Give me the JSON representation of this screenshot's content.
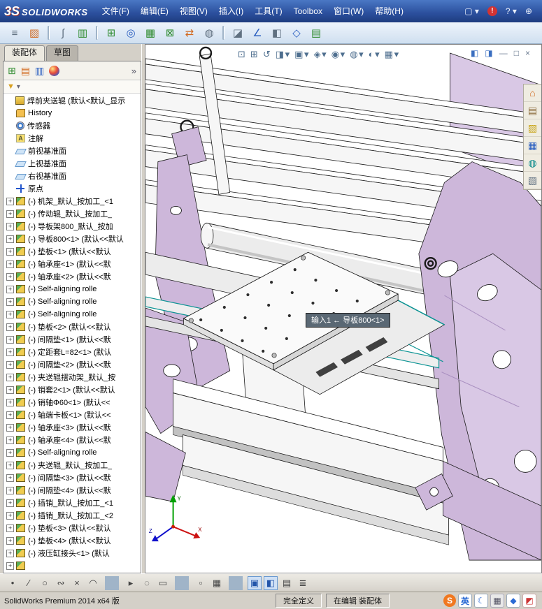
{
  "colors": {
    "titlebar_blue": "#2b4f9d",
    "frame_purple": "#cdb7da",
    "selection_teal": "#0b9393",
    "alert_red": "#d23333"
  },
  "titlebar": {
    "logo_prefix": "3S",
    "logo_text": "SOLIDWORKS",
    "menu": [
      "文件(F)",
      "编辑(E)",
      "视图(V)",
      "插入(I)",
      "工具(T)",
      "Toolbox",
      "窗口(W)",
      "帮助(H)"
    ],
    "right_icons": [
      {
        "name": "new-document-icon",
        "glyph": "▢ ▾"
      },
      {
        "name": "alerts-icon",
        "glyph": "!",
        "cls": "alert"
      },
      {
        "name": "help-menu-icon",
        "glyph": "? ▾"
      },
      {
        "name": "search-icon",
        "glyph": "⊕"
      }
    ]
  },
  "toolbar": {
    "icons": [
      {
        "name": "select-tool-icon",
        "glyph": "≡",
        "cls": "c-gray"
      },
      {
        "name": "edit-component-icon",
        "glyph": "▨",
        "cls": "c-orange"
      },
      {
        "cls": "sep"
      },
      {
        "name": "attachment-icon",
        "glyph": "∫",
        "cls": "c-gray"
      },
      {
        "name": "bom-table-icon",
        "glyph": "▥",
        "cls": "c-green"
      },
      {
        "cls": "sep"
      },
      {
        "name": "insert-component-icon",
        "glyph": "⊞",
        "cls": "c-green"
      },
      {
        "name": "mate-icon",
        "glyph": "◎",
        "cls": "c-blue"
      },
      {
        "name": "component-pattern-icon",
        "glyph": "▦",
        "cls": "c-green"
      },
      {
        "name": "smart-fastener-icon",
        "glyph": "⊠",
        "cls": "c-green"
      },
      {
        "name": "move-component-icon",
        "glyph": "⇄",
        "cls": "c-orange"
      },
      {
        "name": "show-hidden-icon",
        "glyph": "◍",
        "cls": "c-gray"
      },
      {
        "cls": "sep"
      },
      {
        "name": "assembly-features-icon",
        "glyph": "◪",
        "cls": "c-gray"
      },
      {
        "name": "reference-geometry-icon",
        "glyph": "∠",
        "cls": "c-blue"
      },
      {
        "name": "section-view-icon",
        "glyph": "◧",
        "cls": "c-gray"
      },
      {
        "name": "exploded-view-icon",
        "glyph": "◇",
        "cls": "c-blue"
      },
      {
        "name": "interference-check-icon",
        "glyph": "▤",
        "cls": "c-green"
      }
    ]
  },
  "panel": {
    "tabs": [
      {
        "label": "装配体",
        "cls": "active"
      },
      {
        "label": "草图"
      }
    ],
    "view_icons": [
      {
        "name": "feature-manager-icon",
        "glyph": "⊞",
        "cls": "c-green"
      },
      {
        "name": "property-manager-icon",
        "glyph": "▤",
        "cls": "c-orange"
      },
      {
        "name": "configuration-manager-icon",
        "glyph": "▥",
        "cls": "c-blue"
      },
      {
        "name": "display-manager-icon",
        "glyph": "",
        "cls": "sphere"
      }
    ],
    "chevron": "»",
    "filter": {
      "funnel": "▼",
      "caret": "▾"
    },
    "tree": {
      "items": [
        {
          "type": "root",
          "plus": "",
          "label": "焊前夹送辊 (默认<默认_显示"
        },
        {
          "type": "history",
          "plus": "",
          "label": "History"
        },
        {
          "type": "sensor",
          "plus": "",
          "label": "传感器"
        },
        {
          "type": "note",
          "plus": "",
          "label": "注解"
        },
        {
          "type": "plane",
          "plus": "",
          "label": "前视基准面"
        },
        {
          "type": "plane",
          "plus": "",
          "label": "上视基准面"
        },
        {
          "type": "plane",
          "plus": "",
          "label": "右视基准面"
        },
        {
          "type": "origin",
          "plus": "",
          "label": "原点"
        },
        {
          "type": "comp",
          "plus": "+",
          "label": "(-) 机架_默认_按加工_<1"
        },
        {
          "type": "comp",
          "plus": "+",
          "label": "(-) 传动辊_默认_按加工_"
        },
        {
          "type": "comp",
          "plus": "+",
          "label": "(-) 导板架800_默认_按加"
        },
        {
          "type": "comp",
          "plus": "+",
          "label": "(-) 导板800<1> (默认<<默认"
        },
        {
          "type": "comp",
          "plus": "+",
          "label": "(-) 垫板<1> (默认<<默认"
        },
        {
          "type": "comp",
          "plus": "+",
          "label": "(-) 轴承座<1> (默认<<默"
        },
        {
          "type": "comp",
          "plus": "+",
          "label": "(-) 轴承座<2> (默认<<默"
        },
        {
          "type": "comp",
          "plus": "+",
          "label": "(-) Self-aligning rolle"
        },
        {
          "type": "comp",
          "plus": "+",
          "label": "(-) Self-aligning rolle"
        },
        {
          "type": "comp",
          "plus": "+",
          "label": "(-) Self-aligning rolle"
        },
        {
          "type": "comp",
          "plus": "+",
          "label": "(-) 垫板<2> (默认<<默认"
        },
        {
          "type": "comp",
          "plus": "+",
          "label": "(-) 间隔垫<1> (默认<<默"
        },
        {
          "type": "comp",
          "plus": "+",
          "label": "(-) 定距套L=82<1> (默认"
        },
        {
          "type": "comp",
          "plus": "+",
          "label": "(-) 间隔垫<2> (默认<<默"
        },
        {
          "type": "comp",
          "plus": "+",
          "label": "(-) 夹送辊摆动架_默认_按"
        },
        {
          "type": "comp",
          "plus": "+",
          "label": "(-) 销套2<1> (默认<<默认"
        },
        {
          "type": "comp",
          "plus": "+",
          "label": "(-) 销轴Φ60<1> (默认<<"
        },
        {
          "type": "comp",
          "plus": "+",
          "label": "(-) 轴端卡板<1> (默认<<"
        },
        {
          "type": "comp",
          "plus": "+",
          "label": "(-) 轴承座<3> (默认<<默"
        },
        {
          "type": "comp",
          "plus": "+",
          "label": "(-) 轴承座<4> (默认<<默"
        },
        {
          "type": "comp",
          "plus": "+",
          "label": "(-) Self-aligning rolle"
        },
        {
          "type": "comp",
          "plus": "+",
          "label": "(-) 夹送辊_默认_按加工_"
        },
        {
          "type": "comp",
          "plus": "+",
          "label": "(-) 间隔垫<3> (默认<<默"
        },
        {
          "type": "comp",
          "plus": "+",
          "label": "(-) 间隔垫<4> (默认<<默"
        },
        {
          "type": "comp",
          "plus": "+",
          "label": "(-) 插销_默认_按加工_<1"
        },
        {
          "type": "comp",
          "plus": "+",
          "label": "(-) 插销_默认_按加工_<2"
        },
        {
          "type": "comp",
          "plus": "+",
          "label": "(-) 垫板<3> (默认<<默认"
        },
        {
          "type": "comp",
          "plus": "+",
          "label": "(-) 垫板<4> (默认<<默认"
        },
        {
          "type": "comp",
          "plus": "+",
          "label": "(-) 液压缸接头<1> (默认"
        },
        {
          "type": "comp",
          "plus": "+",
          "label": ""
        }
      ]
    }
  },
  "viewport": {
    "headsup": [
      {
        "name": "zoom-fit-icon",
        "glyph": "⊡"
      },
      {
        "name": "zoom-area-icon",
        "glyph": "⊞"
      },
      {
        "name": "previous-view-icon",
        "glyph": "↺"
      },
      {
        "name": "section-view-icon",
        "glyph": "◨ ▾"
      },
      {
        "name": "view-orientation-icon",
        "glyph": "▣ ▾"
      },
      {
        "name": "display-style-icon",
        "glyph": "◈ ▾"
      },
      {
        "name": "hide-show-items-icon",
        "glyph": "◉ ▾"
      },
      {
        "name": "edit-appearance-icon",
        "glyph": "◍ ▾"
      },
      {
        "name": "apply-scene-icon",
        "glyph": "◐ ▾"
      },
      {
        "name": "view-settings-icon",
        "glyph": "▦ ▾"
      }
    ],
    "window_controls": [
      {
        "name": "pane-display-icon",
        "glyph": "◧",
        "cls": "pane"
      },
      {
        "name": "pane-settings-icon",
        "glyph": "◨",
        "cls": "pane"
      },
      {
        "name": "minimize-window-icon",
        "glyph": "—"
      },
      {
        "name": "restore-window-icon",
        "glyph": "□"
      },
      {
        "name": "close-window-icon",
        "glyph": "×"
      }
    ],
    "taskpane": [
      {
        "name": "resources-icon",
        "glyph": "⌂",
        "cls": "c-orange"
      },
      {
        "name": "design-library-icon",
        "glyph": "▤",
        "cls": "c-brown"
      },
      {
        "name": "file-explorer-icon",
        "glyph": "▨",
        "cls": "c-yellow"
      },
      {
        "name": "view-palette-icon",
        "glyph": "▦",
        "cls": "c-blue"
      },
      {
        "name": "appearances-icon",
        "glyph": "◍",
        "cls": "c-teal"
      },
      {
        "name": "custom-properties-icon",
        "glyph": "▧",
        "cls": "c-gray"
      }
    ],
    "tooltip": "输入1 ← 导板800<1>",
    "triad": {
      "x": "X",
      "y": "Y",
      "z": "Z"
    }
  },
  "sketchbar": {
    "icons": [
      {
        "name": "point-icon",
        "glyph": "•"
      },
      {
        "name": "line-icon",
        "glyph": "∕"
      },
      {
        "name": "circle-icon",
        "glyph": "○"
      },
      {
        "name": "spline-icon",
        "glyph": "∾"
      },
      {
        "name": "trim-icon",
        "glyph": "×"
      },
      {
        "name": "arc-icon",
        "glyph": "◠"
      },
      {
        "cls": "sep"
      },
      {
        "name": "select-icon",
        "glyph": "▸"
      },
      {
        "name": "select-loop-icon",
        "glyph": "◌"
      },
      {
        "name": "box-select-icon",
        "glyph": "▭"
      },
      {
        "cls": "sep"
      },
      {
        "name": "snap-icon",
        "glyph": "▫"
      },
      {
        "name": "grid-icon",
        "glyph": "▦"
      },
      {
        "cls": "sep"
      },
      {
        "name": "sketch-settings-icon",
        "glyph": "▣",
        "cls": "c-activeb"
      },
      {
        "name": "rapid-sketch-icon",
        "glyph": "◧",
        "cls": "c-activeb"
      },
      {
        "name": "table-icon",
        "glyph": "▤"
      },
      {
        "name": "dimension-icon",
        "glyph": "≣"
      }
    ]
  },
  "statusbar": {
    "app": "SolidWorks Premium 2014 x64 版",
    "define_state": "完全定义",
    "edit_state": "在编辑 装配体",
    "ime": [
      {
        "name": "sogou-logo-icon",
        "glyph": "S",
        "cls": "ime-s"
      },
      {
        "name": "ime-lang-icon",
        "glyph": "英",
        "cls": "ime-b"
      },
      {
        "name": "ime-moon-icon",
        "glyph": "☾",
        "cls": "ime-b"
      },
      {
        "name": "ime-keyboard-icon",
        "glyph": "▦",
        "cls": "ime-g"
      },
      {
        "name": "ime-tool-icon",
        "glyph": "◆",
        "cls": "ime-b"
      },
      {
        "name": "ime-skin-icon",
        "glyph": "◩",
        "cls": "ime-r"
      }
    ]
  }
}
